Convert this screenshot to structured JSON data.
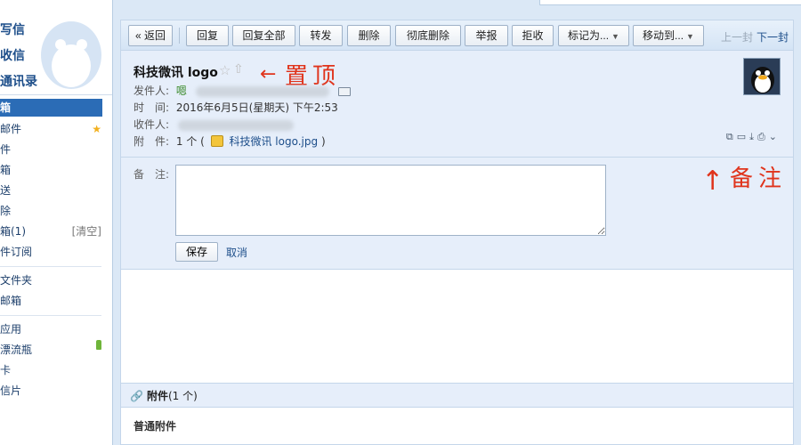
{
  "sidebar": {
    "actions": [
      "写信",
      "收信",
      "通讯录"
    ],
    "folders": [
      {
        "label": "箱",
        "active": true
      },
      {
        "label": "邮件",
        "star": true
      },
      {
        "label": "件"
      },
      {
        "label": "箱"
      },
      {
        "label": "送"
      },
      {
        "label": "除"
      },
      {
        "label": "箱(1)",
        "extra": "[清空]"
      },
      {
        "label": "件订阅"
      }
    ],
    "folders2": [
      {
        "label": "文件夹"
      },
      {
        "label": "邮箱"
      }
    ],
    "apps": [
      {
        "label": "应用"
      },
      {
        "label": "漂流瓶",
        "bottle": true
      },
      {
        "label": "卡"
      },
      {
        "label": "信片"
      }
    ]
  },
  "toolbar": {
    "back": "« 返回",
    "reply": "回复",
    "reply_all": "回复全部",
    "forward": "转发",
    "delete": "删除",
    "delete_perm": "彻底删除",
    "report": "举报",
    "reject": "拒收",
    "mark_as": "标记为...",
    "move_to": "移动到...",
    "prev": "上一封",
    "next": "下一封"
  },
  "email": {
    "subject": "科技微讯 logo",
    "sender_label": "发件人:",
    "sender_name": "嗯",
    "time_label": "时　间:",
    "time_value": "2016年6月5日(星期天) 下午2:53",
    "recipient_label": "收件人:",
    "attachment_label": "附　件:",
    "attachment_count": "1 个 (",
    "attachment_name": "科技微讯 logo.jpg",
    "attachment_close": ")"
  },
  "annotations": {
    "pin": "置顶",
    "remark": "备注",
    "arrow_left": "←",
    "arrow_up": "↑"
  },
  "remark": {
    "label": "备　注:",
    "save": "保存",
    "cancel": "取消"
  },
  "attachments": {
    "title": "附件",
    "count": "(1 个)",
    "section": "普通附件"
  }
}
